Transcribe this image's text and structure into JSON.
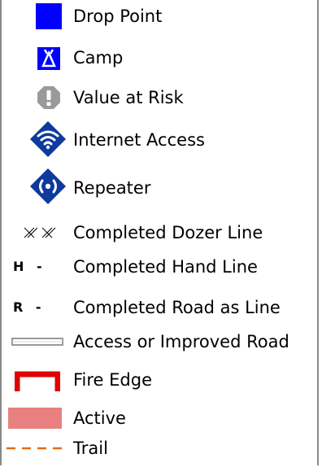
{
  "legend": {
    "items": [
      {
        "label": "Drop Point",
        "icon": "blue-square-icon",
        "color": "#0000ff"
      },
      {
        "label": "Camp",
        "icon": "tent-icon",
        "color": "#0000ff"
      },
      {
        "label": "Value at Risk",
        "icon": "warning-hexagon-icon",
        "color": "#999999"
      },
      {
        "label": "Internet Access",
        "icon": "wifi-diamond-icon",
        "color": "#0d3a9c"
      },
      {
        "label": "Repeater",
        "icon": "repeater-diamond-icon",
        "color": "#0d3a9c"
      },
      {
        "label": "Completed Dozer Line",
        "icon": "dozer-line-icon",
        "color": "#000000"
      },
      {
        "label": "Completed Hand Line",
        "icon": "hand-line-icon",
        "glyph": "H -",
        "color": "#000000"
      },
      {
        "label": "Completed Road as Line",
        "icon": "road-line-icon",
        "glyph": "R -",
        "color": "#000000"
      },
      {
        "label": "Access or Improved Road",
        "icon": "double-line-icon",
        "color": "#999999"
      },
      {
        "label": "Fire Edge",
        "icon": "fire-edge-icon",
        "color": "#e00000"
      },
      {
        "label": "Active",
        "icon": "active-swatch-icon",
        "color": "#e88080"
      },
      {
        "label": "Trail",
        "icon": "dashed-line-icon",
        "color": "#e86a10"
      }
    ]
  }
}
